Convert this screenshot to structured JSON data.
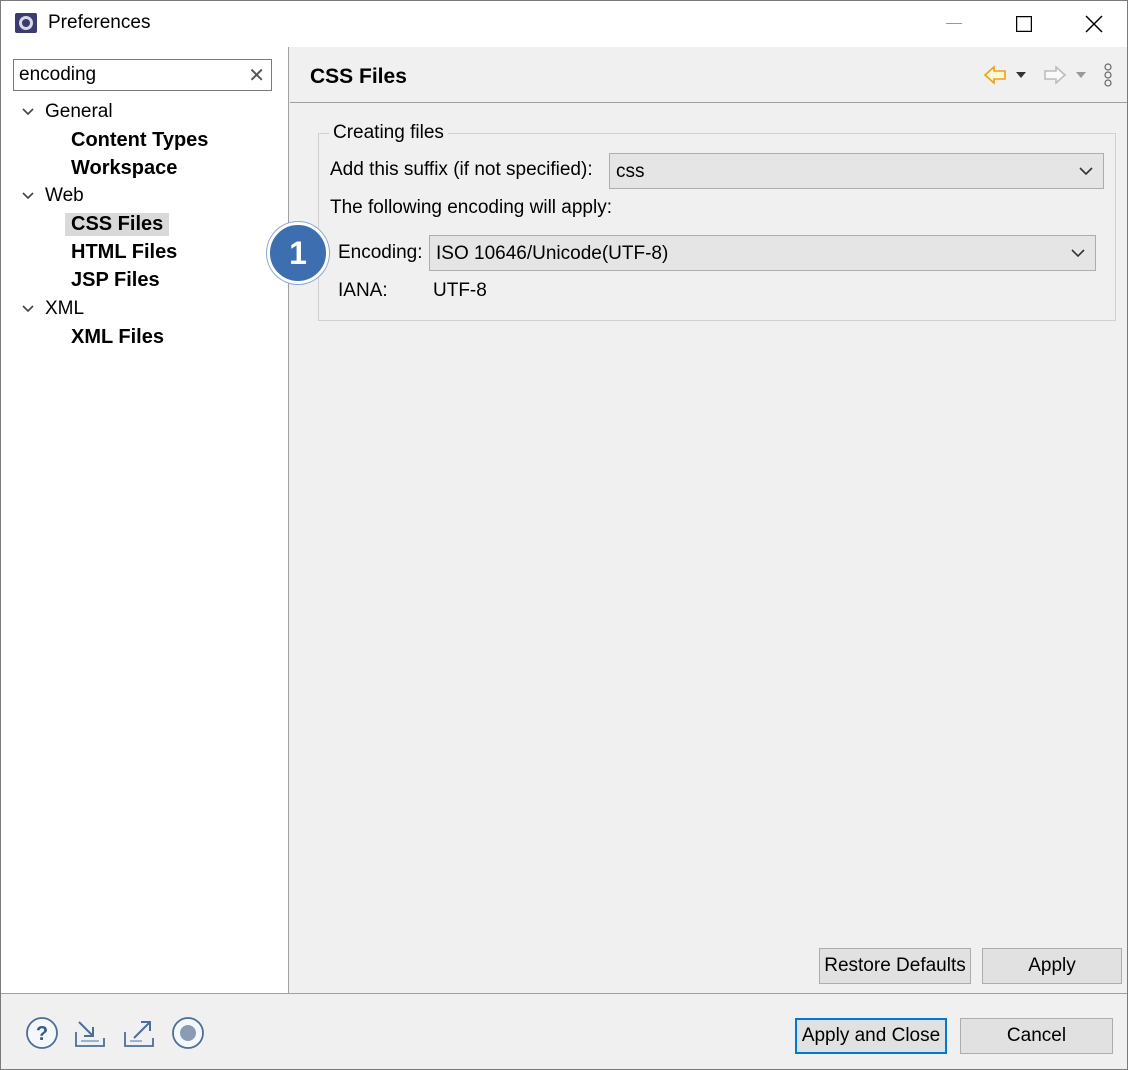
{
  "window": {
    "title": "Preferences"
  },
  "search": {
    "value": "encoding",
    "clear_glyph": "✕"
  },
  "tree": {
    "general": {
      "label": "General",
      "children": [
        "Content Types",
        "Workspace"
      ]
    },
    "web": {
      "label": "Web",
      "children": [
        "CSS Files",
        "HTML Files",
        "JSP Files"
      ]
    },
    "xml": {
      "label": "XML",
      "children": [
        "XML Files"
      ]
    },
    "selected": "CSS Files"
  },
  "page": {
    "title": "CSS Files",
    "group_title": "Creating files",
    "suffix_label": "Add this suffix (if not specified):",
    "suffix_value": "css",
    "encoding_note": "The following encoding will apply:",
    "encoding_label": "Encoding:",
    "encoding_value": "ISO 10646/Unicode(UTF-8)",
    "iana_label": "IANA:",
    "iana_value": "UTF-8",
    "restore_defaults": "Restore Defaults",
    "apply": "Apply"
  },
  "annotation": {
    "badge_number": "1",
    "badge_color": "#3d6fb0"
  },
  "footer": {
    "apply_and_close": "Apply and Close",
    "cancel": "Cancel",
    "icons": [
      "help-icon",
      "import-icon",
      "export-icon",
      "record-icon"
    ]
  },
  "colors": {
    "back_arrow": "#e8a317",
    "accent_border": "#0078d7"
  }
}
